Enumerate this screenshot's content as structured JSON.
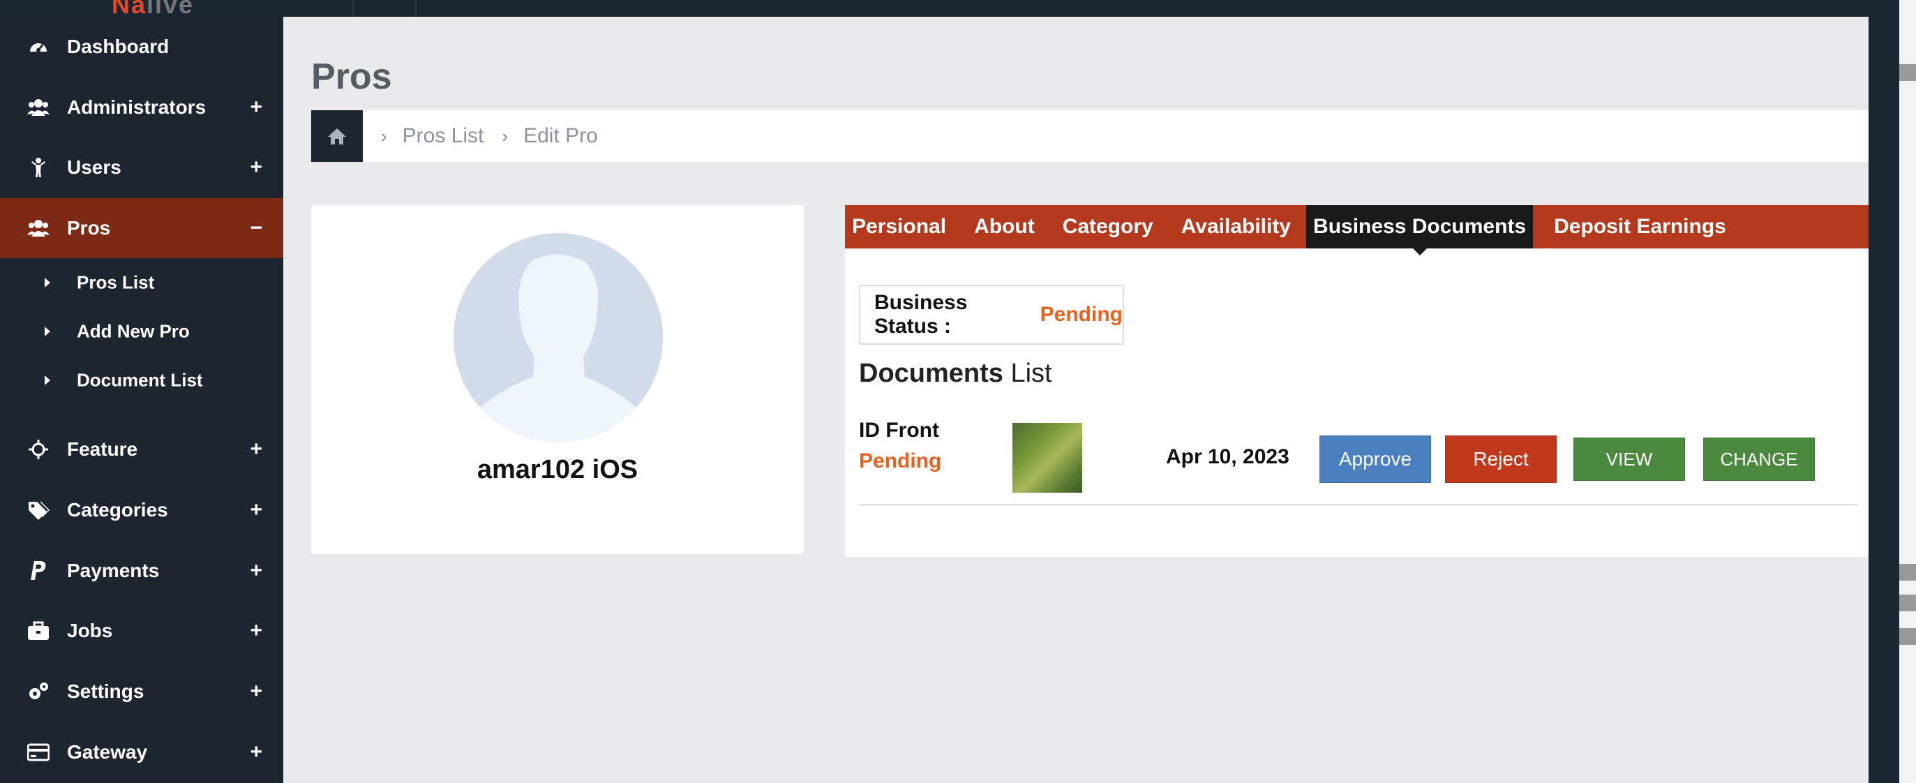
{
  "sidebar": {
    "items": [
      {
        "label": "Dashboard",
        "icon": "dashboard-icon"
      },
      {
        "label": "Administrators",
        "icon": "users-group-icon",
        "toggle": "+"
      },
      {
        "label": "Users",
        "icon": "user-icon",
        "toggle": "+"
      },
      {
        "label": "Pros",
        "icon": "users-group-icon",
        "toggle": "−"
      },
      {
        "label": "Feature",
        "icon": "crosshair-icon",
        "toggle": "+"
      },
      {
        "label": "Categories",
        "icon": "tags-icon",
        "toggle": "+"
      },
      {
        "label": "Payments",
        "icon": "paypal-icon",
        "toggle": "+"
      },
      {
        "label": "Jobs",
        "icon": "briefcase-icon",
        "toggle": "+"
      },
      {
        "label": "Settings",
        "icon": "gears-icon",
        "toggle": "+"
      },
      {
        "label": "Gateway",
        "icon": "credit-card-icon",
        "toggle": "+"
      }
    ],
    "sub_items": [
      {
        "label": "Pros List"
      },
      {
        "label": "Add New Pro"
      },
      {
        "label": "Document List"
      }
    ]
  },
  "page": {
    "title": "Pros",
    "breadcrumb": [
      "Pros List",
      "Edit Pro"
    ]
  },
  "profile": {
    "name": "amar102 iOS"
  },
  "tabs": [
    "Persional",
    "About",
    "Category",
    "Availability",
    "Business Documents",
    "Deposit Earnings"
  ],
  "active_tab": "Business Documents",
  "business_status": {
    "label": "Business Status :",
    "value": "Pending"
  },
  "documents": {
    "title_bold": "Documents",
    "title_rest": "List",
    "rows": [
      {
        "name": "ID Front",
        "status": "Pending",
        "date": "Apr 10, 2023",
        "approve_label": "Approve",
        "reject_label": "Reject",
        "view_label": "VIEW",
        "change_label": "CHANGE"
      }
    ]
  },
  "colors": {
    "accent": "#b5391d",
    "sidebar_active": "#7c2a16",
    "pending": "#e7621f",
    "approve": "#4a7fc0",
    "reject": "#c0391d",
    "view_change": "#4b8a3e"
  }
}
